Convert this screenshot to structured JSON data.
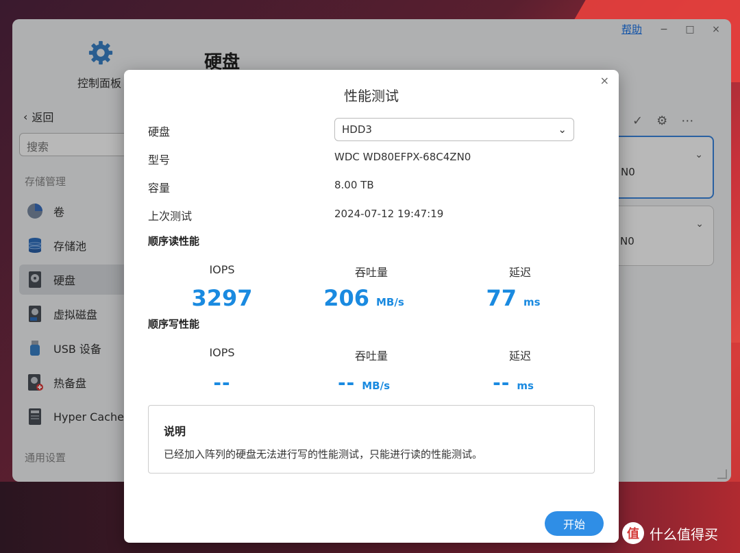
{
  "window": {
    "help_label": "帮助",
    "minimize": "−",
    "maximize": "□",
    "close": "×"
  },
  "app": {
    "control_panel_label": "控制面板",
    "page_title": "硬盘",
    "back_label": "返回",
    "search_placeholder": "搜索"
  },
  "sidebar": {
    "storage_section": "存储管理",
    "items": [
      {
        "label": "卷",
        "icon": "pie-chart-icon"
      },
      {
        "label": "存储池",
        "icon": "database-icon"
      },
      {
        "label": "硬盘",
        "icon": "hard-disk-icon",
        "active": true
      },
      {
        "label": "虚拟磁盘",
        "icon": "virtual-disk-icon"
      },
      {
        "label": "USB 设备",
        "icon": "usb-icon"
      },
      {
        "label": "热备盘",
        "icon": "hot-spare-icon"
      },
      {
        "label": "Hyper Cache",
        "icon": "ssd-cache-icon"
      }
    ],
    "general_section": "通用设置"
  },
  "disk_cards": [
    {
      "text": "N0"
    },
    {
      "text": "N0"
    }
  ],
  "modal": {
    "title": "性能测试",
    "close": "×",
    "fields": {
      "disk_label": "硬盘",
      "disk_value": "HDD3",
      "model_label": "型号",
      "model_value": "WDC WD80EFPX-68C4ZN0",
      "capacity_label": "容量",
      "capacity_value": "8.00 TB",
      "last_test_label": "上次测试",
      "last_test_value": "2024-07-12 19:47:19"
    },
    "seq_read": {
      "title": "顺序读性能",
      "iops_label": "IOPS",
      "iops_value": "3297",
      "throughput_label": "吞吐量",
      "throughput_value": "206",
      "throughput_unit": "MB/s",
      "latency_label": "延迟",
      "latency_value": "77",
      "latency_unit": "ms"
    },
    "seq_write": {
      "title": "顺序写性能",
      "iops_label": "IOPS",
      "iops_value": "--",
      "throughput_label": "吞吐量",
      "throughput_value": "--",
      "throughput_unit": "MB/s",
      "latency_label": "延迟",
      "latency_value": "--",
      "latency_unit": "ms"
    },
    "note": {
      "title": "说明",
      "text": "已经加入阵列的硬盘无法进行写的性能测试，只能进行读的性能测试。"
    },
    "start_button": "开始"
  },
  "watermark": {
    "badge": "值",
    "text": "什么值得买"
  },
  "colors": {
    "accent": "#2f8ee6",
    "metric": "#1a8ae0"
  }
}
